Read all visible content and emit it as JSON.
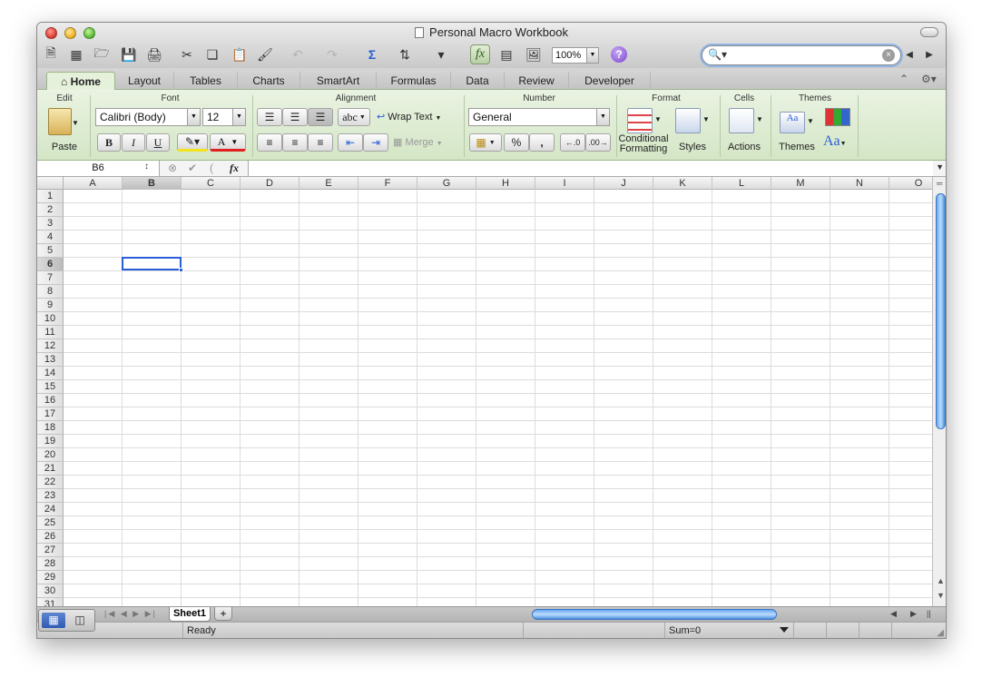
{
  "window": {
    "title": "Personal Macro Workbook"
  },
  "toolbar": {
    "zoom": "100%",
    "formula_button": "fx",
    "search_placeholder": ""
  },
  "tabs": [
    {
      "label": "Home",
      "active": true
    },
    {
      "label": "Layout"
    },
    {
      "label": "Tables"
    },
    {
      "label": "Charts"
    },
    {
      "label": "SmartArt"
    },
    {
      "label": "Formulas"
    },
    {
      "label": "Data"
    },
    {
      "label": "Review"
    },
    {
      "label": "Developer"
    }
  ],
  "ribbon": {
    "groups": {
      "edit": "Edit",
      "font": "Font",
      "alignment": "Alignment",
      "number": "Number",
      "format": "Format",
      "cells": "Cells",
      "themes": "Themes"
    },
    "paste": "Paste",
    "font_name": "Calibri (Body)",
    "font_size": "12",
    "bold": "B",
    "italic": "I",
    "underline": "U",
    "font_color": "A",
    "orientation": "abc",
    "wrap_text": "Wrap Text",
    "merge": "Merge",
    "number_format": "General",
    "percent": "%",
    "comma": ",",
    "conditional_formatting": "Conditional Formatting",
    "styles": "Styles",
    "actions": "Actions",
    "themes": "Themes",
    "theme_fonts": "Aa"
  },
  "formula_bar": {
    "name_box": "B6",
    "fx": "fx",
    "value": ""
  },
  "grid": {
    "columns": [
      "A",
      "B",
      "C",
      "D",
      "E",
      "F",
      "G",
      "H",
      "I",
      "J",
      "K",
      "L",
      "M",
      "N",
      "O"
    ],
    "rows": [
      "1",
      "2",
      "3",
      "4",
      "5",
      "6",
      "7",
      "8",
      "9",
      "10",
      "11",
      "12",
      "13",
      "14",
      "15",
      "16",
      "17",
      "18",
      "19",
      "20",
      "21",
      "22",
      "23",
      "24",
      "25",
      "26",
      "27",
      "28",
      "29",
      "30",
      "31"
    ],
    "selected_cell": "B6"
  },
  "sheets": {
    "tabs": [
      "Sheet1"
    ],
    "add": "+"
  },
  "status": {
    "mode": "Ready",
    "sum": "Sum=0"
  },
  "colors": {
    "accent_green": "#d4e6c6",
    "selection_blue": "#2a5ed6",
    "scroll_blue": "#6aa8ec"
  }
}
